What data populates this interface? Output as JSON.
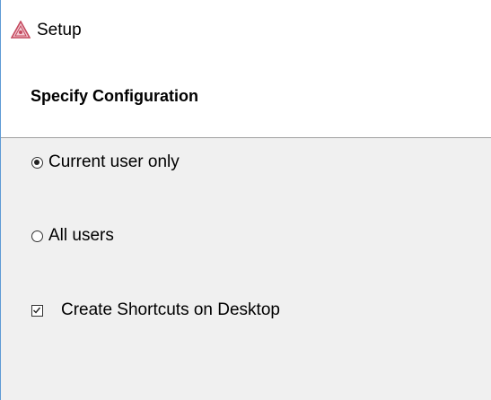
{
  "window": {
    "title": "Setup",
    "icon": "triangle-app-icon",
    "accent": "#c44a5f"
  },
  "header": {
    "title": "Specify Configuration"
  },
  "install_scope": {
    "options": [
      {
        "label": "Current user only",
        "selected": true
      },
      {
        "label": "All users",
        "selected": false
      }
    ]
  },
  "shortcuts": {
    "label": "Create Shortcuts on Desktop",
    "checked": true
  }
}
